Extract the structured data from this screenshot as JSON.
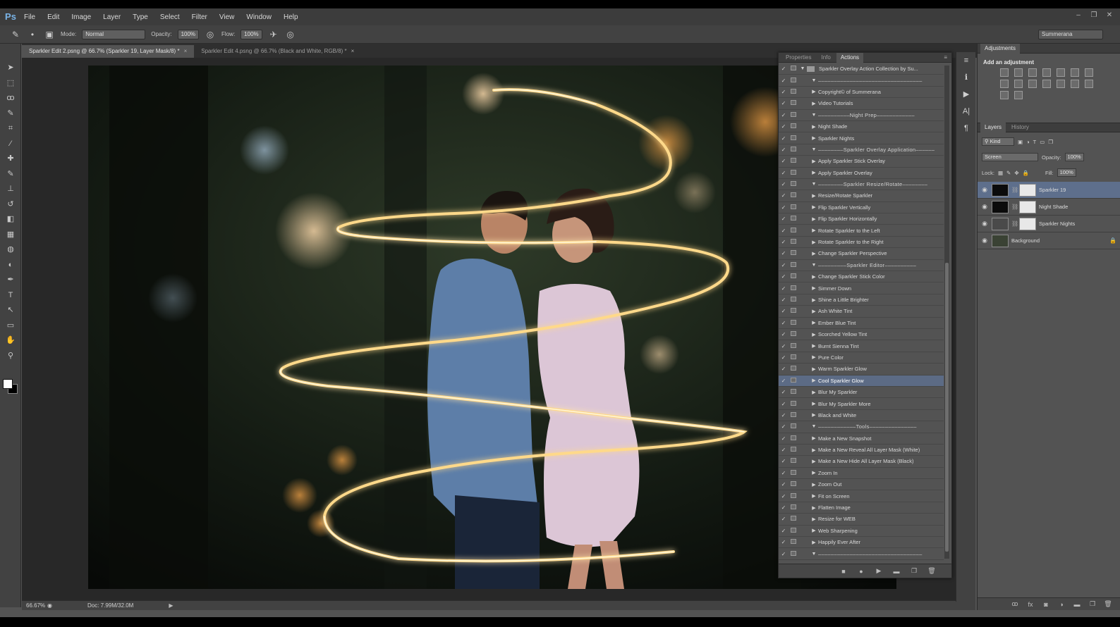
{
  "app": {
    "logo": "Ps"
  },
  "menu": [
    "File",
    "Edit",
    "Image",
    "Layer",
    "Type",
    "Select",
    "Filter",
    "View",
    "Window",
    "Help"
  ],
  "window_controls": {
    "minimize": "‒",
    "restore": "❐",
    "close": "✕"
  },
  "options_bar": {
    "mode_label": "Mode:",
    "mode_value": "Normal",
    "opacity_label": "Opacity:",
    "opacity_value": "100%",
    "flow_label": "Flow:",
    "flow_value": "100%",
    "workspace": "Summerana"
  },
  "tools": [
    "move-tool",
    "marquee-tool",
    "lasso-tool",
    "quick-select-tool",
    "crop-tool",
    "eyedropper-tool",
    "healing-tool",
    "brush-tool",
    "clone-stamp-tool",
    "history-brush-tool",
    "eraser-tool",
    "gradient-tool",
    "blur-tool",
    "dodge-tool",
    "pen-tool",
    "type-tool",
    "path-select-tool",
    "shape-tool",
    "hand-tool",
    "zoom-tool"
  ],
  "tool_glyphs": [
    "➤",
    "⬚",
    "ꝏ",
    "✎",
    "⌗",
    "⁄",
    "✚",
    "✎",
    "⊥",
    "↺",
    "◧",
    "▦",
    "◍",
    "◐",
    "✒",
    "T",
    "↖",
    "▭",
    "✋",
    "⚲"
  ],
  "doc_tabs": [
    {
      "label": "Sparkler Edit 2.psng @ 66.7% (Sparkler 19, Layer Mask/8) *",
      "active": true
    },
    {
      "label": "Sparkler Edit 4.psng @ 66.7% (Black and White, RGB/8) *",
      "active": false
    }
  ],
  "status": {
    "zoom": "66.67%",
    "doc": "Doc: 7.99M/32.0M"
  },
  "actions_panel": {
    "tabs": [
      {
        "label": "Properties",
        "active": false
      },
      {
        "label": "Info",
        "active": false
      },
      {
        "label": "Actions",
        "active": true
      }
    ],
    "items": [
      {
        "label": "Sparkler Overlay Action Collection by Su...",
        "type": "set"
      },
      {
        "label": "‒‒‒‒‒‒‒‒‒‒‒‒‒‒‒‒‒‒‒‒‒‒‒‒‒‒‒‒‒‒‒‒‒",
        "type": "sep"
      },
      {
        "label": "Copyright© of Summerana",
        "type": "action"
      },
      {
        "label": "Video Tutorials",
        "type": "action"
      },
      {
        "label": "‒‒‒‒‒‒‒‒‒‒Night Prep‒‒‒‒‒‒‒‒‒‒‒‒",
        "type": "sep"
      },
      {
        "label": "Night Shade",
        "type": "action"
      },
      {
        "label": "Sparkler Nights",
        "type": "action"
      },
      {
        "label": "‒‒‒‒‒‒‒‒Sparkler Overlay Application‒‒‒‒‒‒",
        "type": "sep"
      },
      {
        "label": "Apply Sparkler Stick Overlay",
        "type": "action"
      },
      {
        "label": "Apply Sparkler Overlay",
        "type": "action"
      },
      {
        "label": "‒‒‒‒‒‒‒‒Sparkler Resize/Rotate‒‒‒‒‒‒‒‒",
        "type": "sep"
      },
      {
        "label": "Resize/Rotate Sparkler",
        "type": "action"
      },
      {
        "label": "Flip Sparkler Vertically",
        "type": "action"
      },
      {
        "label": "Flip Sparkler Horizontally",
        "type": "action"
      },
      {
        "label": "Rotate Sparkler to the Left",
        "type": "action"
      },
      {
        "label": "Rotate Sparkler to the Right",
        "type": "action"
      },
      {
        "label": "Change Sparkler Perspective",
        "type": "action"
      },
      {
        "label": "‒‒‒‒‒‒‒‒‒Sparkler Editor‒‒‒‒‒‒‒‒‒‒",
        "type": "sep"
      },
      {
        "label": "Change Sparkler Stick Color",
        "type": "action"
      },
      {
        "label": "Simmer Down",
        "type": "action"
      },
      {
        "label": "Shine a Little Brighter",
        "type": "action"
      },
      {
        "label": "Ash White Tint",
        "type": "action"
      },
      {
        "label": "Ember Blue Tint",
        "type": "action"
      },
      {
        "label": "Scorched Yellow Tint",
        "type": "action"
      },
      {
        "label": "Burnt Sienna Tint",
        "type": "action"
      },
      {
        "label": "Pure Color",
        "type": "action"
      },
      {
        "label": "Warm Sparkler Glow",
        "type": "action"
      },
      {
        "label": "Cool Sparkler Glow",
        "type": "action",
        "selected": true
      },
      {
        "label": "Blur My Sparkler",
        "type": "action"
      },
      {
        "label": "Blur My Sparkler More",
        "type": "action"
      },
      {
        "label": "Black and White",
        "type": "action"
      },
      {
        "label": "‒‒‒‒‒‒‒‒‒‒‒‒Tools‒‒‒‒‒‒‒‒‒‒‒‒‒‒‒",
        "type": "sep"
      },
      {
        "label": "Make a New Snapshot",
        "type": "action"
      },
      {
        "label": "Make a New Reveal All Layer Mask (White)",
        "type": "action"
      },
      {
        "label": "Make a New Hide All Layer Mask (Black)",
        "type": "action"
      },
      {
        "label": "Zoom In",
        "type": "action"
      },
      {
        "label": "Zoom Out",
        "type": "action"
      },
      {
        "label": "Fit on Screen",
        "type": "action"
      },
      {
        "label": "Flatten Image",
        "type": "action"
      },
      {
        "label": "Resize for WEB",
        "type": "action"
      },
      {
        "label": "Web Sharpening",
        "type": "action"
      },
      {
        "label": "Happily Ever After",
        "type": "action"
      },
      {
        "label": "‒‒‒‒‒‒‒‒‒‒‒‒‒‒‒‒‒‒‒‒‒‒‒‒‒‒‒‒‒‒‒‒‒",
        "type": "sep"
      }
    ],
    "footer": [
      "■",
      "●",
      "▶",
      "▬",
      "❐",
      "🗑"
    ]
  },
  "icon_strip": [
    "≡",
    "ℹ",
    "▶",
    "A|",
    "¶"
  ],
  "adjustments": {
    "tab": "Adjustments",
    "title": "Add an adjustment"
  },
  "layers": {
    "tabs": [
      {
        "label": "Layers",
        "active": true
      },
      {
        "label": "History",
        "active": false
      }
    ],
    "kind": "⚲ Kind",
    "blend": "Screen",
    "opacity_label": "Opacity:",
    "opacity": "100%",
    "lock_label": "Lock:",
    "fill_label": "Fill:",
    "fill": "100%",
    "items": [
      {
        "name": "Sparkler 19",
        "thumb": "dark",
        "mask": "white",
        "selected": true
      },
      {
        "name": "Night Shade",
        "thumb": "dark",
        "mask": "white",
        "selected": false
      },
      {
        "name": "Sparkler Nights",
        "thumb": "adj",
        "mask": "white",
        "selected": false
      },
      {
        "name": "Background",
        "thumb": "photo-t",
        "mask": null,
        "selected": false,
        "locked": true
      }
    ],
    "footer": [
      "ꝏ",
      "fx",
      "◙",
      "◑",
      "▬",
      "❐",
      "🗑"
    ]
  },
  "colors": {
    "accent": "#5c6b85",
    "sparkler": "#ffd27a"
  }
}
